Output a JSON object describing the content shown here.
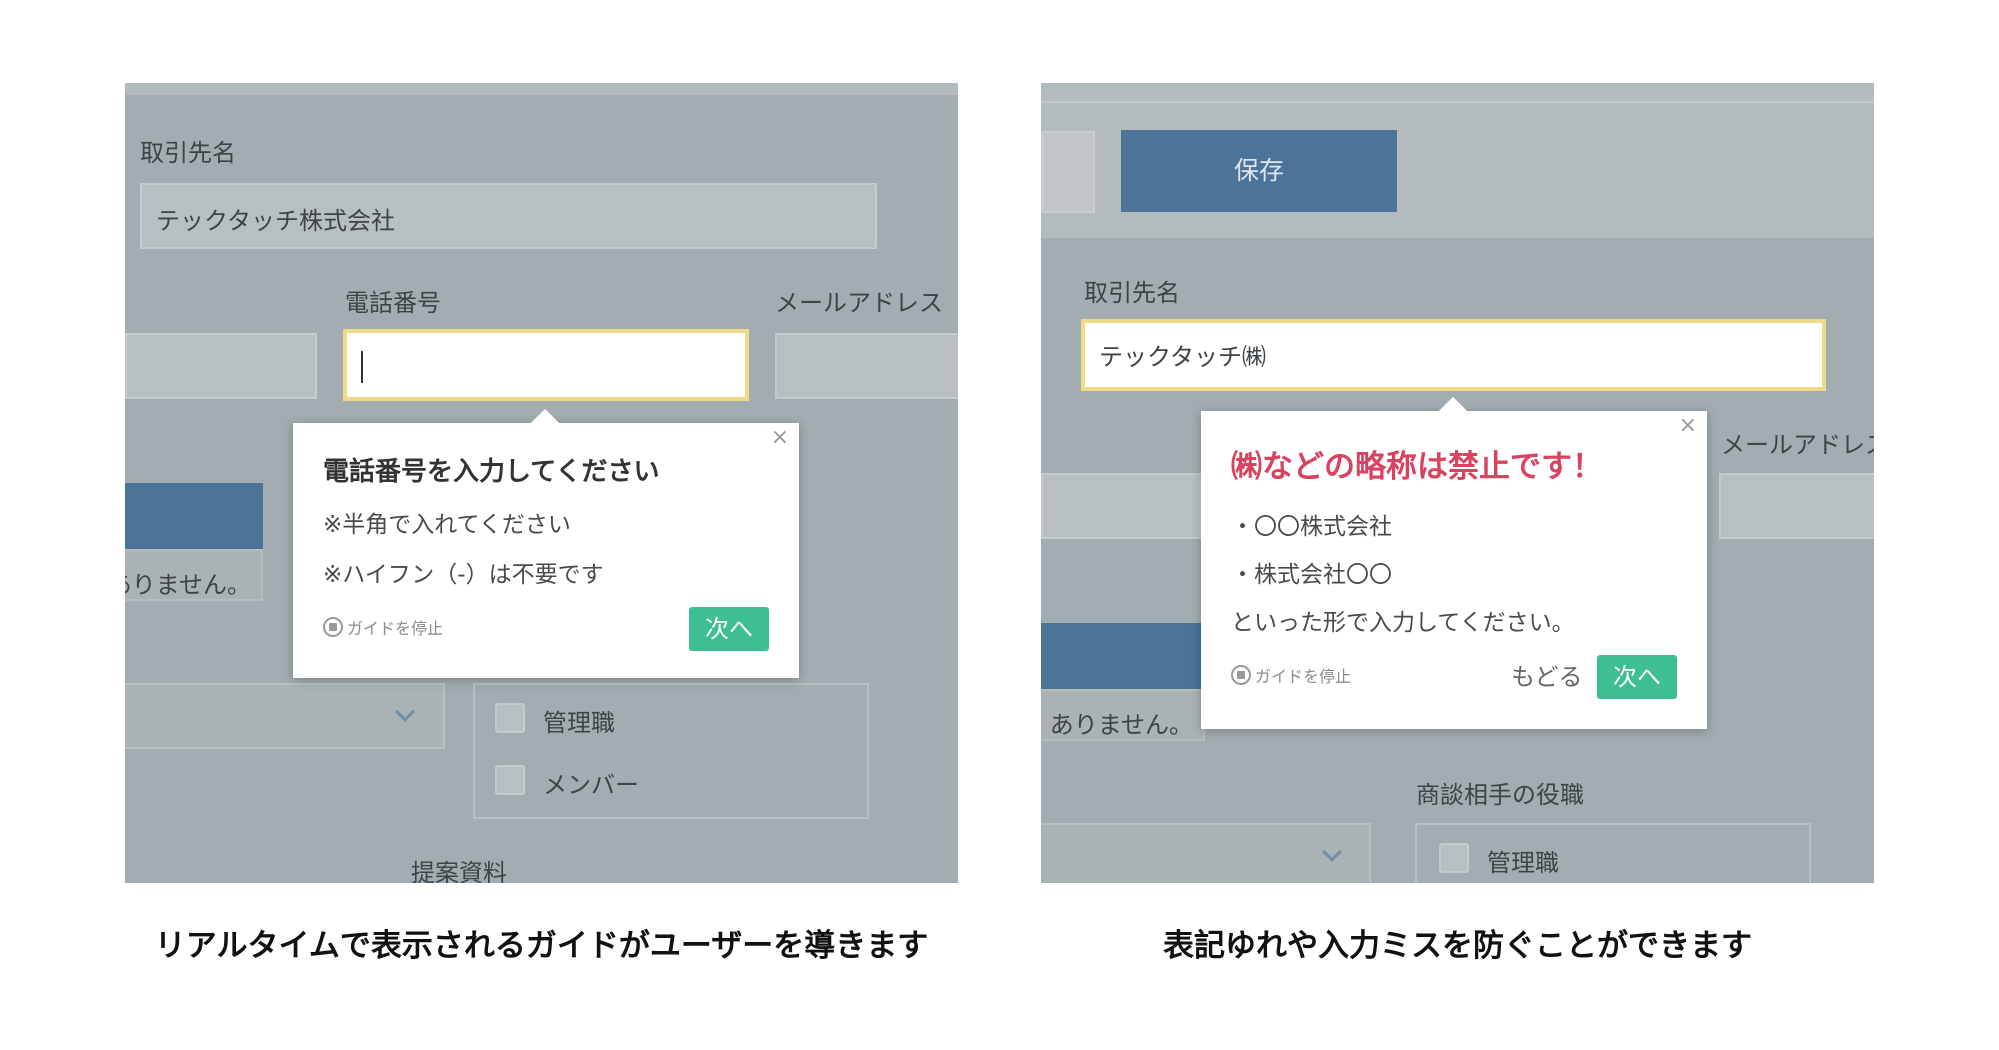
{
  "left": {
    "client_label": "取引先名",
    "client_value": "テックタッチ株式会社",
    "phone_label": "電話番号",
    "phone_value": "",
    "email_label": "メールアドレス",
    "note_text": "ありません。",
    "checkbox_manager": "管理職",
    "checkbox_member": "メンバー",
    "materials_label": "提案資料",
    "tooltip": {
      "title": "電話番号を入力してください",
      "line1": "※半角で入れてください",
      "line2": "※ハイフン（-）は不要です",
      "stop_guide": "ガイドを停止",
      "next": "次へ",
      "close": "×"
    }
  },
  "right": {
    "save_label": "保存",
    "client_label": "取引先名",
    "client_value": "テックタッチ㈱",
    "email_label": "メールアドレス",
    "note_text": "ありません。",
    "position_label": "商談相手の役職",
    "checkbox_manager": "管理職",
    "tooltip": {
      "title": "㈱などの略称は禁止です！",
      "line1": "・〇〇株式会社",
      "line2": "・株式会社〇〇",
      "line3": "といった形で入力してください。",
      "stop_guide": "ガイドを停止",
      "back": "もどる",
      "next": "次へ",
      "close": "×"
    }
  },
  "captions": {
    "left": "リアルタイムで表示されるガイドがユーザーを導きます",
    "right": "表記ゆれや入力ミスを防ぐことができます"
  },
  "colors": {
    "overlay": "#a3acb0",
    "button_blue": "#4b7498",
    "next_green": "#3ebf93",
    "highlight_border": "#eddb86",
    "warning_red": "#d9435f"
  },
  "icons": [
    "close-icon",
    "stop-guide-icon",
    "chevron-down-icon"
  ]
}
